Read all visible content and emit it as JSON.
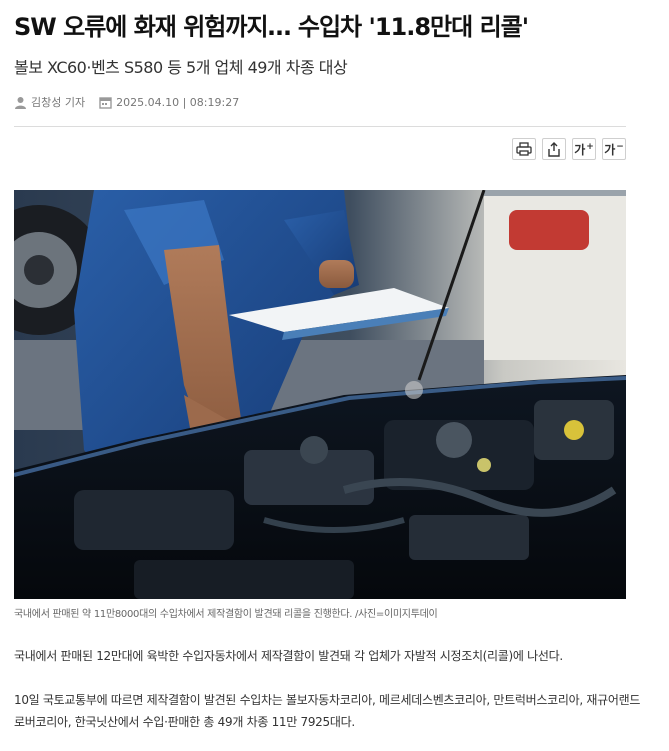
{
  "article": {
    "title": "SW 오류에 화재 위험까지… 수입차 '11.8만대 리콜'",
    "subtitle": "볼보 XC60·벤츠 S580 등 5개 업체 49개 차종 대상",
    "author": "김창성 기자",
    "datetime": "2025.04.10 | 08:19:27",
    "icons": {
      "author": "person-icon",
      "date": "calendar-icon",
      "print": "print-icon",
      "share": "share-icon",
      "font_up": "font-increase-icon",
      "font_down": "font-decrease-icon"
    },
    "tools": {
      "font_up_label": "가",
      "font_down_label": "가"
    },
    "image_caption": "국내에서 판매된 약 11만8000대의 수입차에서 제작결함이 발견돼 리콜을 진행한다. /사진=이미지투데이",
    "paragraphs": [
      "국내에서 판매된 12만대에 육박한 수입자동차에서 제작결함이 발견돼 각 업체가 자발적 시정조치(리콜)에 나선다.",
      "10일 국토교통부에 따르면 제작결함이 발견된 수입차는 볼보자동차코리아, 메르세데스벤츠코리아, 만트럭버스코리아, 재규어랜드로버코리아, 한국닛산에서 수입·판매한 총 49개 차종 11만 7925대다."
    ]
  }
}
